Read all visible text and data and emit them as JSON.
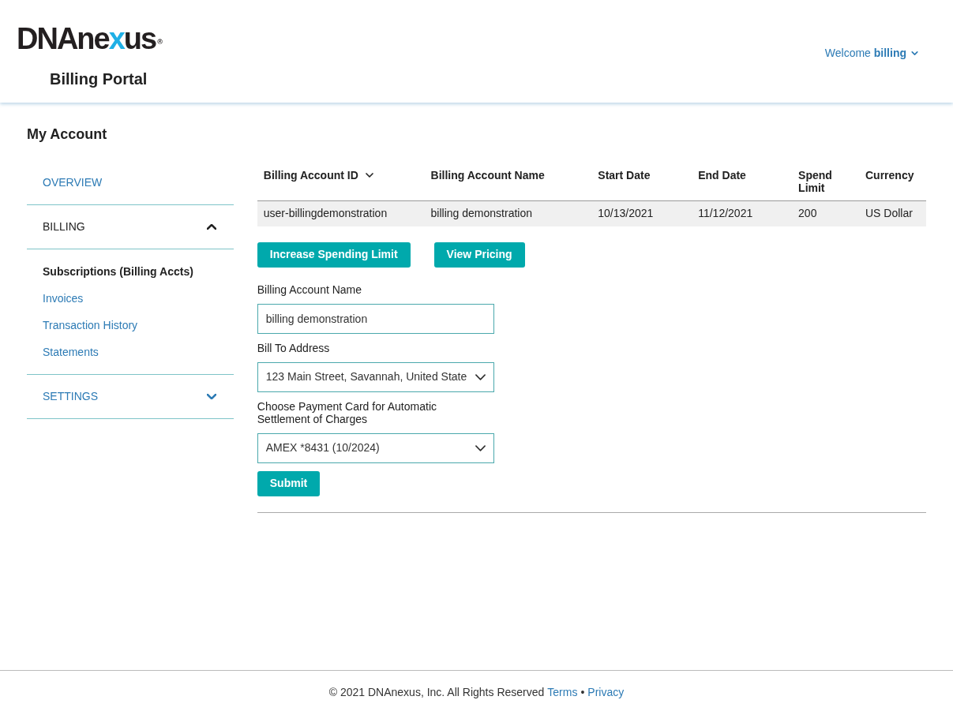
{
  "header": {
    "logo": {
      "lead": "DNAne",
      "accent": "x",
      "tail": "us",
      "mark": "®"
    },
    "subtitle": "Billing Portal",
    "welcome": "Welcome",
    "user": "billing"
  },
  "page_title": "My Account",
  "sidebar": [
    {
      "label": "OVERVIEW",
      "kind": "link"
    },
    {
      "label": "BILLING",
      "kind": "section",
      "expanded": true,
      "children": [
        {
          "label": "Subscriptions (Billing Accts)",
          "selected": true
        },
        {
          "label": "Invoices",
          "selected": false
        },
        {
          "label": "Transaction History",
          "selected": false
        },
        {
          "label": "Statements",
          "selected": false
        }
      ]
    },
    {
      "label": "SETTINGS",
      "kind": "section",
      "expanded": false
    }
  ],
  "table": {
    "columns": [
      {
        "label": "Billing Account ID",
        "sorted": true
      },
      {
        "label": "Billing Account Name",
        "sorted": false
      },
      {
        "label": "Start Date",
        "sorted": false
      },
      {
        "label": "End Date",
        "sorted": false
      },
      {
        "label": "Spend Limit",
        "sorted": false
      },
      {
        "label": "Currency",
        "sorted": false
      }
    ],
    "rows": [
      [
        "user-billingdemonstration",
        "billing demonstration",
        "10/13/2021",
        "11/12/2021",
        "200",
        "US Dollar"
      ]
    ]
  },
  "actions": [
    "Increase Spending Limit",
    "View Pricing"
  ],
  "form": {
    "fields": [
      {
        "kind": "text",
        "label": "Billing Account Name",
        "value": "billing demonstration"
      },
      {
        "kind": "select",
        "label": "Bill To Address",
        "value": "123 Main Street, Savannah, United State"
      },
      {
        "kind": "select",
        "label": "Choose Payment Card for Automatic Settlement of Charges",
        "value": "AMEX *8431 (10/2024)"
      }
    ],
    "submit": "Submit"
  },
  "footer": {
    "copyright": "© 2021 DNAnexus, Inc. All Rights Reserved",
    "terms": "Terms",
    "separator": "•",
    "privacy": "Privacy"
  }
}
